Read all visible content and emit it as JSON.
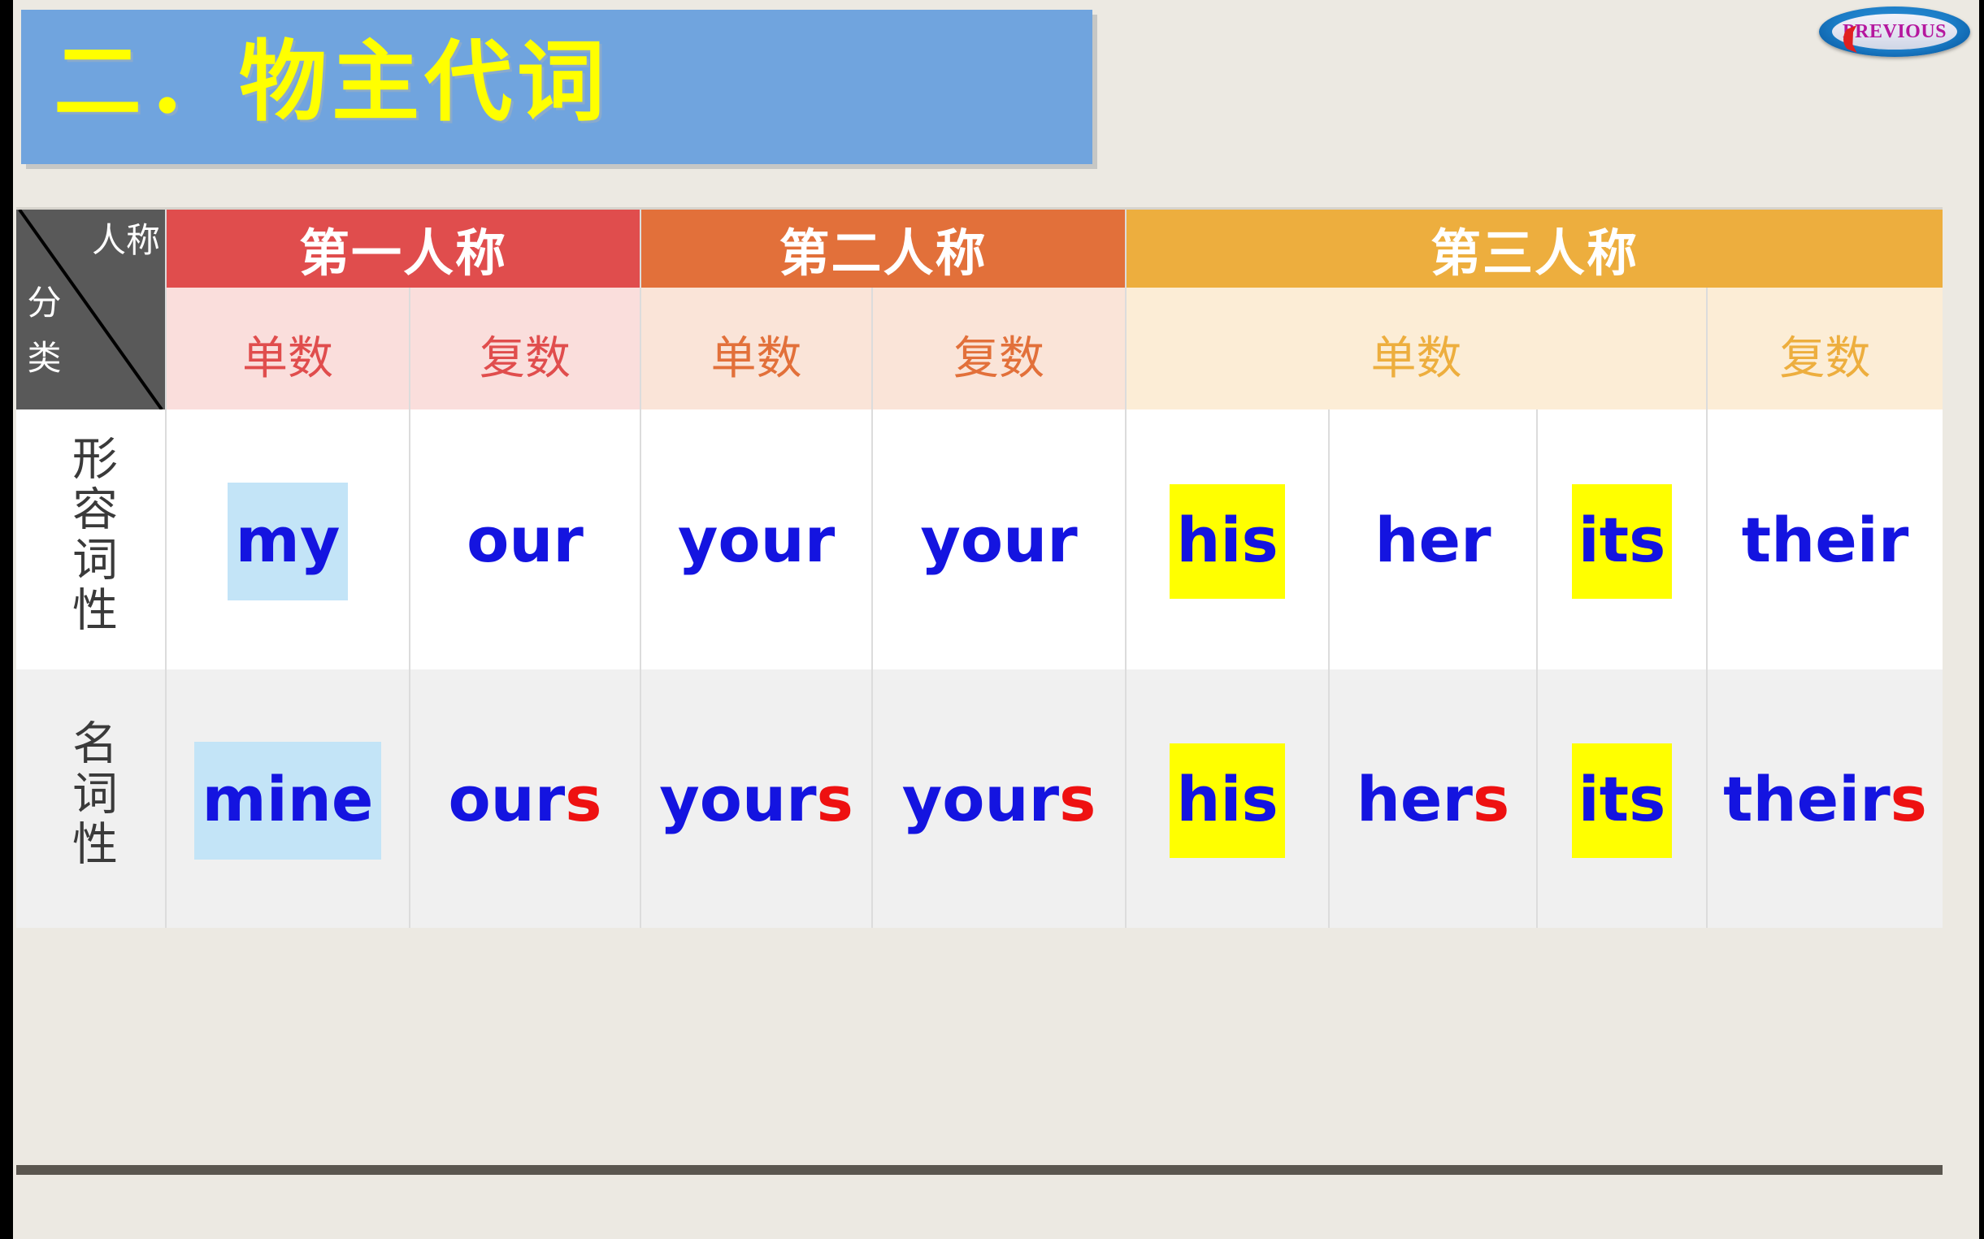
{
  "slide": {
    "title": "二．物主代词",
    "background_color": "#ECE9E2",
    "banner_color": "#70A4DE",
    "title_color": "#FFFF00"
  },
  "nav": {
    "previous_label": "PREVIOUS"
  },
  "table": {
    "corner": {
      "person_label": "人称",
      "category_label": "分类"
    },
    "person_headers": [
      {
        "label": "第一人称",
        "color": "#E04D4D",
        "colspan": 2
      },
      {
        "label": "第二人称",
        "color": "#E2703A",
        "colspan": 2
      },
      {
        "label": "第三人称",
        "color": "#EDAE3E",
        "colspan": 4
      }
    ],
    "number_headers": [
      {
        "label": "单数",
        "color": "#E04D4D",
        "bg": "#FADEDC",
        "colspan": 1
      },
      {
        "label": "复数",
        "color": "#E04D4D",
        "bg": "#FADEDC",
        "colspan": 1
      },
      {
        "label": "单数",
        "color": "#E2703A",
        "bg": "#FAE4D8",
        "colspan": 1
      },
      {
        "label": "复数",
        "color": "#E2703A",
        "bg": "#FAE4D8",
        "colspan": 1
      },
      {
        "label": "单数",
        "color": "#EDAE3E",
        "bg": "#FCEDD6",
        "colspan": 3
      },
      {
        "label": "复数",
        "color": "#EDAE3E",
        "bg": "#FCEDD6",
        "colspan": 1
      }
    ],
    "rows": [
      {
        "label": "形容词性",
        "cells": [
          {
            "stem": "my",
            "suffix": "",
            "highlight": "blue"
          },
          {
            "stem": "our",
            "suffix": "",
            "highlight": "none"
          },
          {
            "stem": "your",
            "suffix": "",
            "highlight": "none"
          },
          {
            "stem": "your",
            "suffix": "",
            "highlight": "none"
          },
          {
            "stem": "his",
            "suffix": "",
            "highlight": "yellow"
          },
          {
            "stem": "her",
            "suffix": "",
            "highlight": "none"
          },
          {
            "stem": "its",
            "suffix": "",
            "highlight": "yellow"
          },
          {
            "stem": "their",
            "suffix": "",
            "highlight": "none"
          }
        ]
      },
      {
        "label": "名词性",
        "cells": [
          {
            "stem": "mine",
            "suffix": "",
            "highlight": "blue"
          },
          {
            "stem": "our",
            "suffix": "s",
            "highlight": "none"
          },
          {
            "stem": "your",
            "suffix": "s",
            "highlight": "none"
          },
          {
            "stem": "your",
            "suffix": "s",
            "highlight": "none"
          },
          {
            "stem": "his",
            "suffix": "",
            "highlight": "yellow"
          },
          {
            "stem": "her",
            "suffix": "s",
            "highlight": "none"
          },
          {
            "stem": "its",
            "suffix": "",
            "highlight": "yellow"
          },
          {
            "stem": "their",
            "suffix": "s",
            "highlight": "none"
          }
        ]
      }
    ],
    "colors": {
      "text_blue": "#1414E0",
      "suffix_red": "#EE1111",
      "highlight_blue": "#C3E4F7",
      "highlight_yellow": "#FFFF00",
      "corner_bg": "#595959",
      "row2_bg": "#F0F0F0"
    }
  }
}
